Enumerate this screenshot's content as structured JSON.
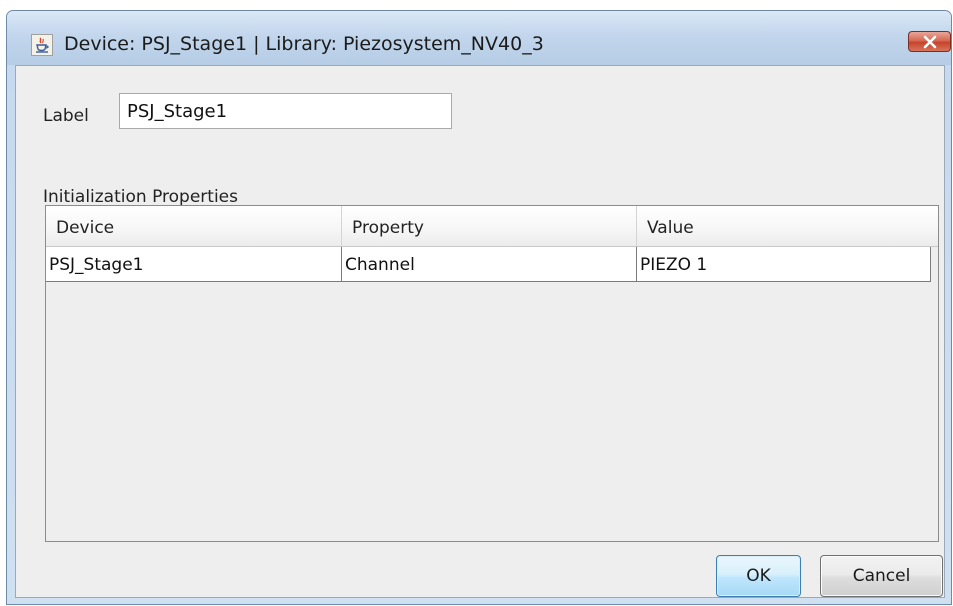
{
  "window": {
    "title": "Device: PSJ_Stage1 | Library: Piezosystem_NV40_3",
    "app_icon": "java-icon",
    "close_icon": "close-icon"
  },
  "form": {
    "label_caption": "Label",
    "label_value": "PSJ_Stage1"
  },
  "init_properties": {
    "caption": "Initialization Properties",
    "columns": [
      "Device",
      "Property",
      "Value"
    ],
    "rows": [
      {
        "device": "PSJ_Stage1",
        "property": "Channel",
        "value": "PIEZO 1"
      }
    ]
  },
  "buttons": {
    "ok_label": "OK",
    "cancel_label": "Cancel"
  },
  "colors": {
    "titlebar": "#c2d6ec",
    "close_button": "#c5442b",
    "ok_button": "#bee6fd",
    "dialog_background": "#eeeeee"
  }
}
